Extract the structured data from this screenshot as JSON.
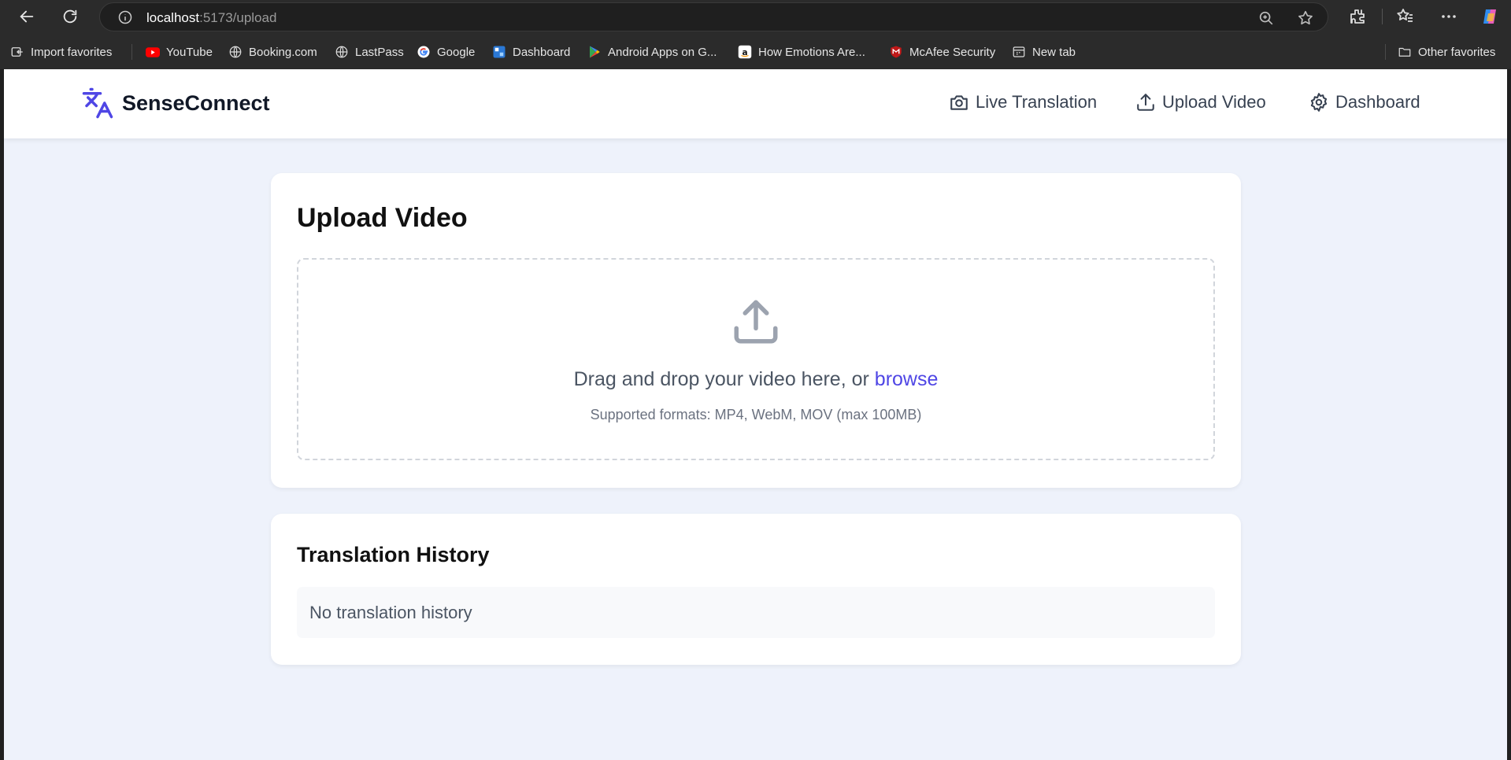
{
  "browser": {
    "url_host": "localhost",
    "url_path": ":5173/upload",
    "bookmarks": [
      {
        "label": "Import favorites",
        "icon": "import-icon"
      },
      {
        "label": "YouTube",
        "icon": "youtube-icon",
        "color": "#ff0000"
      },
      {
        "label": "Booking.com",
        "icon": "globe-icon"
      },
      {
        "label": "LastPass",
        "icon": "globe-icon"
      },
      {
        "label": "Google",
        "icon": "google-icon"
      },
      {
        "label": "Dashboard",
        "icon": "dashboard-icon"
      },
      {
        "label": "Android Apps on G...",
        "icon": "play-store-icon"
      },
      {
        "label": "How Emotions Are...",
        "icon": "amazon-icon"
      },
      {
        "label": "McAfee Security",
        "icon": "mcafee-icon",
        "color": "#c01818"
      },
      {
        "label": "New tab",
        "icon": "new-tab-icon"
      }
    ],
    "other_favorites": "Other favorites"
  },
  "app": {
    "brand": "SenseConnect",
    "accent": "#4f46e5",
    "nav": [
      {
        "label": "Live Translation",
        "icon": "camera-icon"
      },
      {
        "label": "Upload Video",
        "icon": "upload-icon"
      },
      {
        "label": "Dashboard",
        "icon": "gear-icon"
      }
    ]
  },
  "upload": {
    "title": "Upload Video",
    "drop_text": "Drag and drop your video here, or",
    "browse": "browse",
    "formats": "Supported formats: MP4, WebM, MOV (max 100MB)"
  },
  "history": {
    "title": "Translation History",
    "empty": "No translation history"
  }
}
